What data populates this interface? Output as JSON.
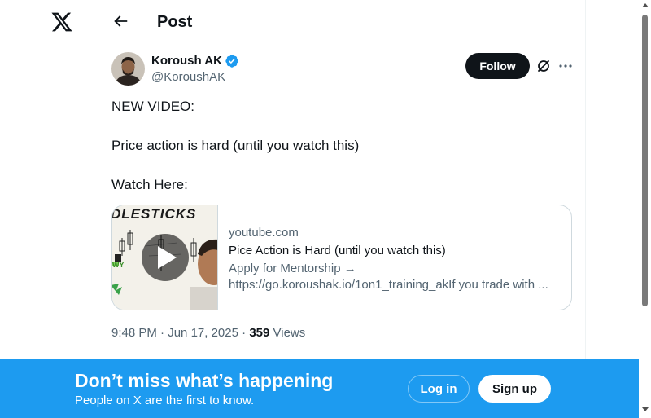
{
  "nav": {
    "logo_icon": "x-logo-icon"
  },
  "header": {
    "back_icon": "arrow-left-icon",
    "title": "Post"
  },
  "author": {
    "name": "Koroush AK",
    "handle": "@KoroushAK",
    "verified_icon": "verified-badge-icon",
    "verified_color": "#1d9bf0"
  },
  "actions": {
    "follow_label": "Follow",
    "grok_icon": "grok-icon",
    "more_icon": "more-dots-icon"
  },
  "tweet": {
    "lines": [
      "NEW VIDEO:",
      "Price action is hard (until you watch this)",
      "Watch Here:"
    ]
  },
  "card": {
    "thumbnail_text": "DLESTICKS",
    "play_icon": "play-icon",
    "domain": "youtube.com",
    "title": "Pice Action is Hard (until you watch this)",
    "desc_line1": "Apply for Mentorship →",
    "desc_line2": "https://go.koroushak.io/1on1_training_akIf you trade with ..."
  },
  "meta": {
    "time": "9:48 PM",
    "date": "Jun 17, 2025",
    "views_count": "359",
    "views_label": "Views"
  },
  "banner": {
    "title": "Don’t miss what’s happening",
    "subtitle": "People on X are the first to know.",
    "login_label": "Log in",
    "signup_label": "Sign up",
    "background": "#1d9bf0"
  }
}
